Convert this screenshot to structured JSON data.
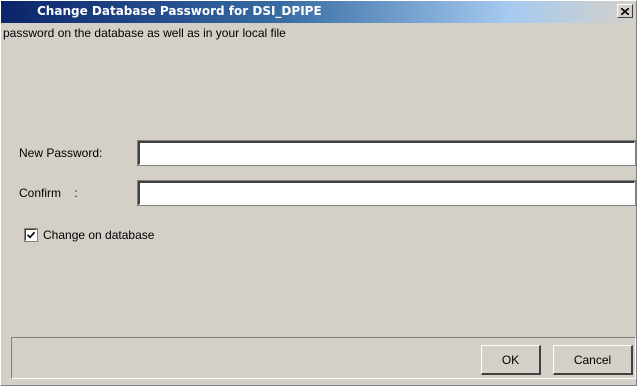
{
  "window": {
    "title": "Change Database Password for DSI_DPIPE",
    "close_icon": "close-icon"
  },
  "message": "password on the database as well as in your local file",
  "form": {
    "new_password_label": "New Password:",
    "new_password_value": "",
    "confirm_label": "Confirm    :",
    "confirm_value": "",
    "change_on_database_label": "Change on database",
    "change_on_database_checked": true
  },
  "buttons": {
    "ok_label": "OK",
    "cancel_label": "Cancel"
  },
  "colors": {
    "title_gradient_start": "#0a246a",
    "title_gradient_end": "#d4d0c8",
    "dialog_background": "#d4d0c8"
  }
}
